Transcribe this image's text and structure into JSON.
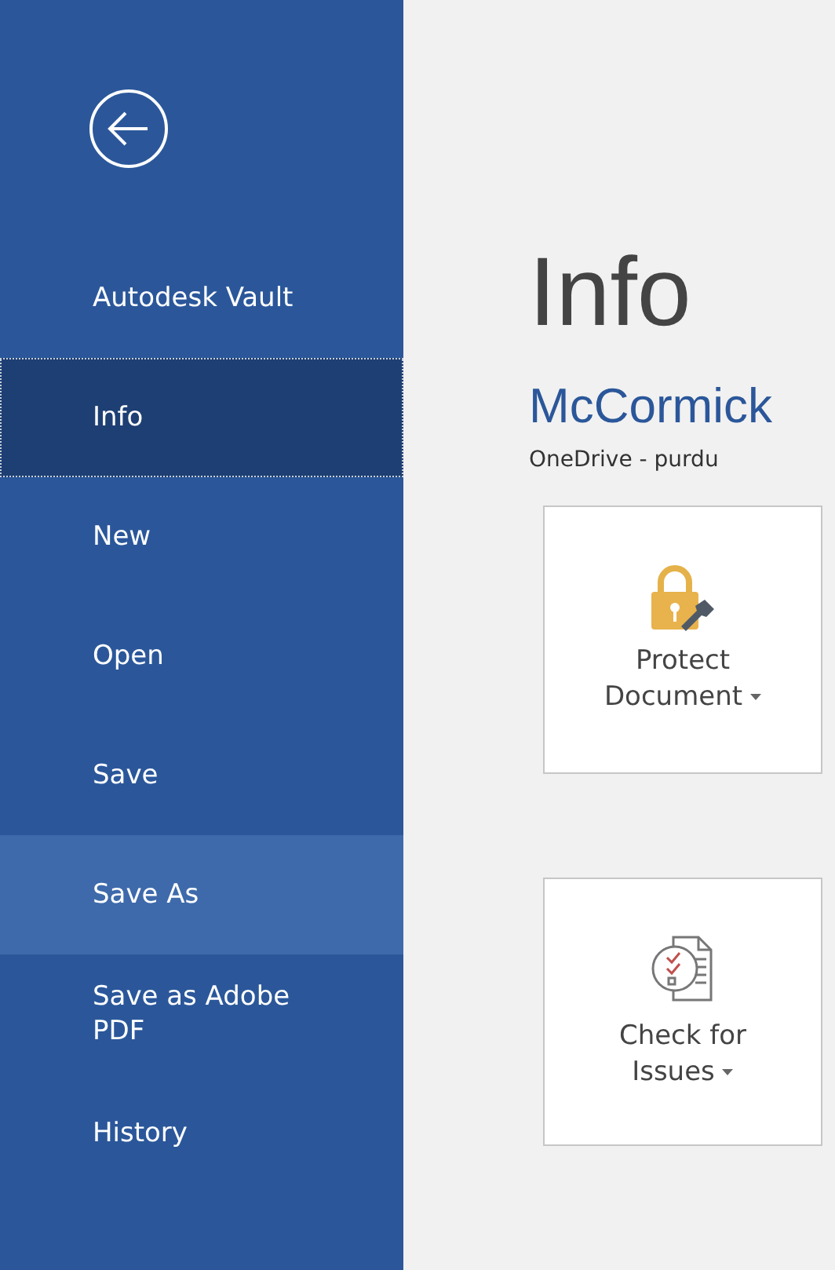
{
  "sidebar": {
    "items": [
      {
        "label": "Autodesk Vault",
        "selected": false,
        "hovered": false
      },
      {
        "label": "Info",
        "selected": true,
        "hovered": false
      },
      {
        "label": "New",
        "selected": false,
        "hovered": false
      },
      {
        "label": "Open",
        "selected": false,
        "hovered": false
      },
      {
        "label": "Save",
        "selected": false,
        "hovered": false
      },
      {
        "label": "Save As",
        "selected": false,
        "hovered": true
      },
      {
        "label": "Save as Adobe PDF",
        "selected": false,
        "hovered": false
      },
      {
        "label": "History",
        "selected": false,
        "hovered": false
      }
    ]
  },
  "main": {
    "title": "Info",
    "document_name": "McCormick",
    "location": "OneDrive - purdu",
    "actions": [
      {
        "kind": "protect",
        "lines": [
          "Protect",
          "Document"
        ]
      },
      {
        "kind": "check",
        "lines": [
          "Check for",
          "Issues"
        ]
      }
    ]
  }
}
